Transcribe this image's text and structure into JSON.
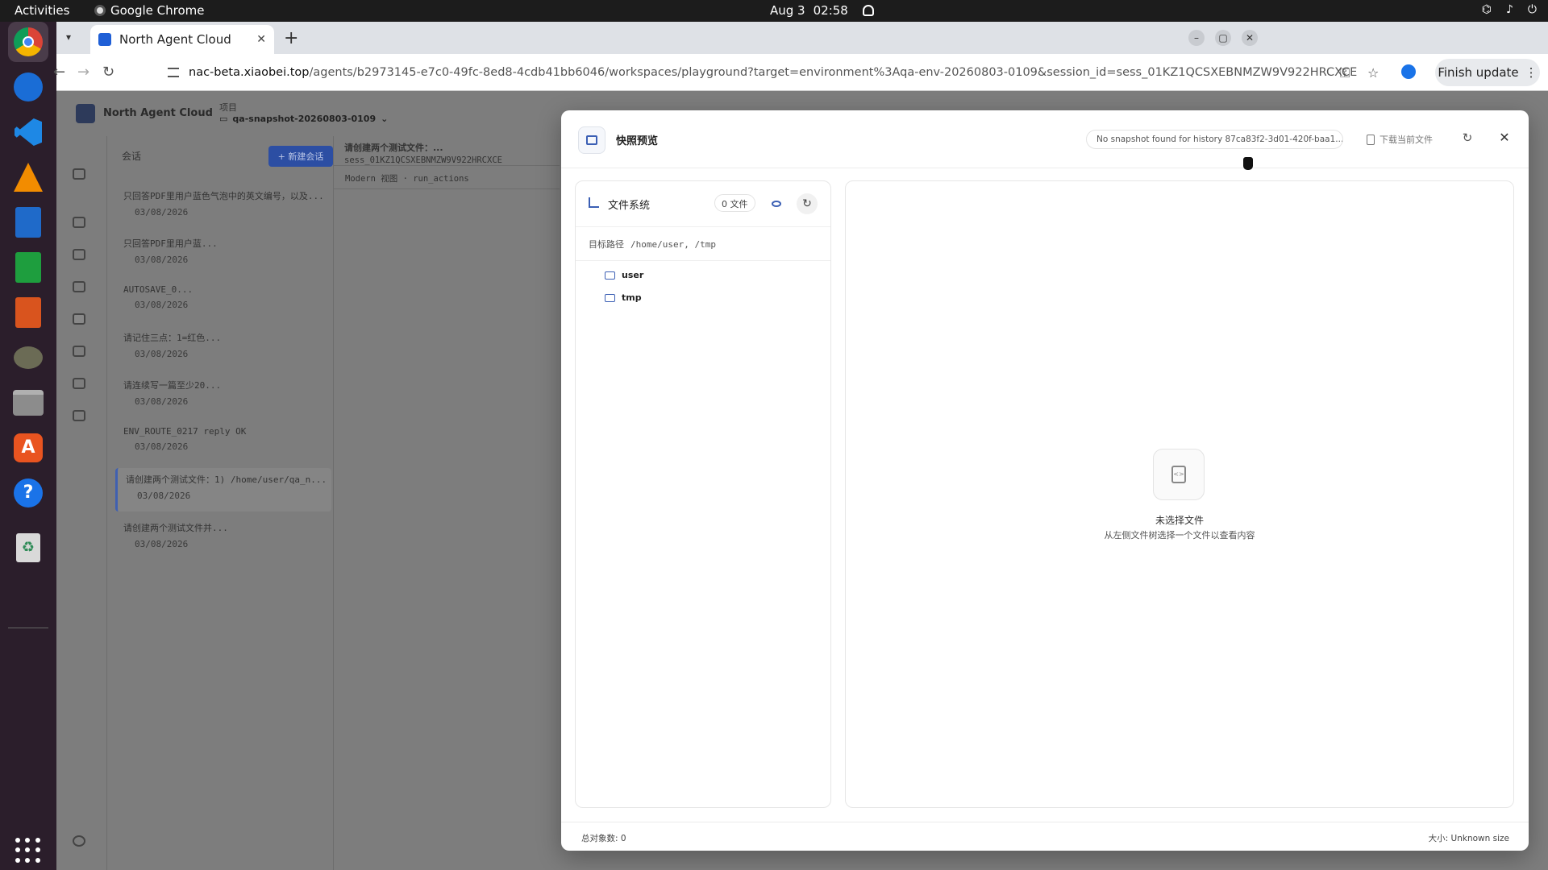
{
  "system": {
    "activities": "Activities",
    "app_name": "Google Chrome",
    "date": "Aug 3",
    "time": "02:58"
  },
  "browser": {
    "tab_title": "North Agent Cloud",
    "url_host": "nac-beta.xiaobei.top",
    "url_path": "/agents/b2973145-e7c0-49fc-8ed8-4cdb41bb6046/workspaces/playground?target=environment%3Aqa-env-20260803-0109&session_id=sess_01KZ1QCSXEBNMZW9V922HRCXCE",
    "finish_update": "Finish update"
  },
  "app": {
    "brand": "North Agent Cloud",
    "project_label": "项目",
    "project_value": "qa-snapshot-20260803-0109",
    "sessions_title": "会话",
    "new_session": "+ 新建会话",
    "sessions": [
      {
        "title": "只回答PDF里用户蓝色气泡中的英文编号，以及...",
        "date": "03/08/2026"
      },
      {
        "title": "只回答PDF里用户蓝...",
        "date": "03/08/2026"
      },
      {
        "title": "AUTOSAVE_0...",
        "date": "03/08/2026"
      },
      {
        "title": "请记住三点：1=红色...",
        "date": "03/08/2026"
      },
      {
        "title": "请连续写一篇至少20...",
        "date": "03/08/2026"
      },
      {
        "title": "ENV_ROUTE_0217 reply OK",
        "date": "03/08/2026"
      },
      {
        "title": "请创建两个测试文件：1) /home/user/qa_n...",
        "date": "03/08/2026"
      },
      {
        "title": "请创建两个测试文件并...",
        "date": "03/08/2026"
      }
    ],
    "chat_title": "请创建两个测试文件：...",
    "chat_session": "sess_01KZ1QCSXEBNMZW9V922HRCXCE",
    "chat_mode": "Modern 视图 · run_actions"
  },
  "modal": {
    "title": "快照预览",
    "status": "No snapshot found for history 87ca83f2-3d01-420f-baa1...",
    "download": "下载当前文件",
    "fs_title": "文件系统",
    "file_count": "0 文件",
    "target_label": "目标路径",
    "target_value": "/home/user, /tmp",
    "tree": [
      "user",
      "tmp"
    ],
    "empty_title": "未选择文件",
    "empty_subtitle": "从左侧文件树选择一个文件以查看内容",
    "total_objects": "总对象数: 0",
    "size": "大小: Unknown size"
  }
}
